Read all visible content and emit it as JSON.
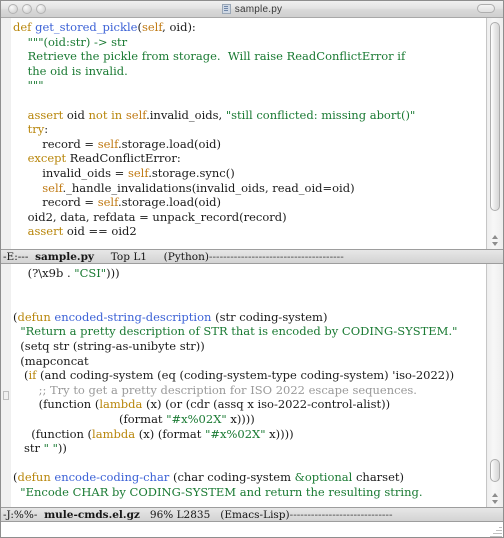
{
  "window": {
    "title": "sample.py",
    "traffic_lights": [
      "close",
      "minimize",
      "zoom"
    ]
  },
  "buffers": [
    {
      "name": "python-buffer",
      "modeline": {
        "flags": "-E:---",
        "buffer_name": "sample.py",
        "position": "Top",
        "line": "L1",
        "major_mode": "(Python)",
        "fill": "--------------------------------------"
      },
      "scrollbar": {
        "thumb_top_pct": 2,
        "thumb_height_pct": 88
      },
      "lines": [
        [
          {
            "t": "def ",
            "c": "kw"
          },
          {
            "t": "get_stored_pickle",
            "c": "fn"
          },
          {
            "t": "(",
            "c": "ty"
          },
          {
            "t": "self",
            "c": "self"
          },
          {
            "t": ", oid):",
            "c": "ty"
          }
        ],
        [
          {
            "t": "    ",
            "c": "ty"
          },
          {
            "t": "\"\"\"(oid:str) -> str",
            "c": "str"
          }
        ],
        [
          {
            "t": "    Retrieve the pickle from storage.  Will raise ReadConflictError if",
            "c": "str"
          }
        ],
        [
          {
            "t": "    the oid is invalid.",
            "c": "str"
          }
        ],
        [
          {
            "t": "    \"\"\"",
            "c": "str"
          }
        ],
        [
          {
            "t": "",
            "c": "ty"
          }
        ],
        [
          {
            "t": "    ",
            "c": "ty"
          },
          {
            "t": "assert",
            "c": "kw"
          },
          {
            "t": " oid ",
            "c": "ty"
          },
          {
            "t": "not in",
            "c": "kw"
          },
          {
            "t": " ",
            "c": "ty"
          },
          {
            "t": "self",
            "c": "self"
          },
          {
            "t": ".invalid_oids, ",
            "c": "ty"
          },
          {
            "t": "\"still conflicted: missing abort()\"",
            "c": "str"
          }
        ],
        [
          {
            "t": "    ",
            "c": "ty"
          },
          {
            "t": "try",
            "c": "kw"
          },
          {
            "t": ":",
            "c": "ty"
          }
        ],
        [
          {
            "t": "        record = ",
            "c": "ty"
          },
          {
            "t": "self",
            "c": "self"
          },
          {
            "t": ".storage.load(oid)",
            "c": "ty"
          }
        ],
        [
          {
            "t": "    ",
            "c": "ty"
          },
          {
            "t": "except",
            "c": "kw"
          },
          {
            "t": " ReadConflictError:",
            "c": "ty"
          }
        ],
        [
          {
            "t": "        invalid_oids = ",
            "c": "ty"
          },
          {
            "t": "self",
            "c": "self"
          },
          {
            "t": ".storage.sync()",
            "c": "ty"
          }
        ],
        [
          {
            "t": "        ",
            "c": "ty"
          },
          {
            "t": "self",
            "c": "self"
          },
          {
            "t": "._handle_invalidations(invalid_oids, read_oid=oid)",
            "c": "ty"
          }
        ],
        [
          {
            "t": "        record = ",
            "c": "ty"
          },
          {
            "t": "self",
            "c": "self"
          },
          {
            "t": ".storage.load(oid)",
            "c": "ty"
          }
        ],
        [
          {
            "t": "    oid2, data, refdata = unpack_record(record)",
            "c": "ty"
          }
        ],
        [
          {
            "t": "    ",
            "c": "ty"
          },
          {
            "t": "assert",
            "c": "kw"
          },
          {
            "t": " oid == oid2",
            "c": "ty"
          }
        ]
      ]
    },
    {
      "name": "lisp-buffer",
      "modeline": {
        "flags": "-J:%%-",
        "buffer_name": "mule-cmds.el.gz",
        "position": "96%",
        "line": "L2835",
        "major_mode": "(Emacs-Lisp)",
        "fill": "-----------------------------"
      },
      "scrollbar": {
        "thumb_top_pct": 86,
        "thumb_height_pct": 10
      },
      "lines": [
        [
          {
            "t": "    (?\\x9b . ",
            "c": "ty"
          },
          {
            "t": "\"CSI\"",
            "c": "str"
          },
          {
            "t": ")))",
            "c": "ty"
          }
        ],
        [
          {
            "t": "",
            "c": "ty"
          }
        ],
        [
          {
            "t": "",
            "c": "ty"
          }
        ],
        [
          {
            "t": "(",
            "c": "ty"
          },
          {
            "t": "defun",
            "c": "kw"
          },
          {
            "t": " ",
            "c": "ty"
          },
          {
            "t": "encoded-string-description",
            "c": "fn"
          },
          {
            "t": " (str coding-system)",
            "c": "ty"
          }
        ],
        [
          {
            "t": "  ",
            "c": "ty"
          },
          {
            "t": "\"Return a pretty description of STR that is encoded by CODING-SYSTEM.\"",
            "c": "str"
          }
        ],
        [
          {
            "t": "  (setq str (string-as-unibyte str))",
            "c": "ty"
          }
        ],
        [
          {
            "t": "  (mapconcat",
            "c": "ty"
          }
        ],
        [
          {
            "t": "   (",
            "c": "ty"
          },
          {
            "t": "if",
            "c": "kw"
          },
          {
            "t": " (and coding-system (eq (coding-system-type coding-system) 'iso-2022))",
            "c": "ty"
          }
        ],
        [
          {
            "t": "       ;; Try to get a pretty description for ISO 2022 escape sequences.",
            "c": "cmt"
          }
        ],
        [
          {
            "t": "       (function (",
            "c": "ty"
          },
          {
            "t": "lambda",
            "c": "kw"
          },
          {
            "t": " (x) (or (cdr (assq x iso-2022-control-alist))",
            "c": "ty"
          }
        ],
        [
          {
            "t": "                             (format ",
            "c": "ty"
          },
          {
            "t": "\"#x%02X\"",
            "c": "str"
          },
          {
            "t": " x))))",
            "c": "ty"
          }
        ],
        [
          {
            "t": "     (function (",
            "c": "ty"
          },
          {
            "t": "lambda",
            "c": "kw"
          },
          {
            "t": " (x) (format ",
            "c": "ty"
          },
          {
            "t": "\"#x%02X\"",
            "c": "str"
          },
          {
            "t": " x))))",
            "c": "ty"
          }
        ],
        [
          {
            "t": "   str ",
            "c": "ty"
          },
          {
            "t": "\" \"",
            "c": "str"
          },
          {
            "t": "))",
            "c": "ty"
          }
        ],
        [
          {
            "t": "",
            "c": "ty"
          }
        ],
        [
          {
            "t": "(",
            "c": "ty"
          },
          {
            "t": "defun",
            "c": "kw"
          },
          {
            "t": " ",
            "c": "ty"
          },
          {
            "t": "encode-coding-char",
            "c": "fn"
          },
          {
            "t": " (char coding-system ",
            "c": "ty"
          },
          {
            "t": "&optional",
            "c": "str"
          },
          {
            "t": " charset)",
            "c": "ty"
          }
        ],
        [
          {
            "t": "  \"Encode CHAR by CODING-SYSTEM and return the resulting string.",
            "c": "str"
          }
        ]
      ]
    }
  ],
  "colors": {
    "keyword": "#b8860b",
    "string": "#1a7a33",
    "comment": "#9a9a9a",
    "function": "#3b61d6",
    "text": "#1a1a1a",
    "modeline_bg": "#d9d9d9"
  }
}
